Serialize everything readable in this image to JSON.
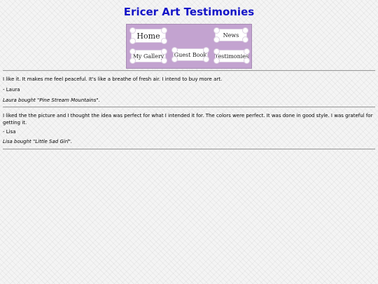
{
  "page": {
    "title": "Ericer Art Testimonies"
  },
  "nav": {
    "home": "Home",
    "news": "News",
    "gallery": "My Gallery",
    "guestbook": "Guest Book",
    "testimonies": "Testimonies"
  },
  "testimonies": [
    {
      "quote": "I like it. It makes me feel peaceful. It's like a breathe of fresh air. I intend to buy more art.",
      "author": "- Laura",
      "purchase": "Laura bought \"Pine Stream Mountains\"."
    },
    {
      "quote": "I liked the the picture and I thought the idea was perfect for what I intended it for. The colors were perfect. It was done in good style. I was grateful for getting it.",
      "author": "- Lisa",
      "purchase": "Lisa bought \"Little Sad Girl\"."
    }
  ]
}
